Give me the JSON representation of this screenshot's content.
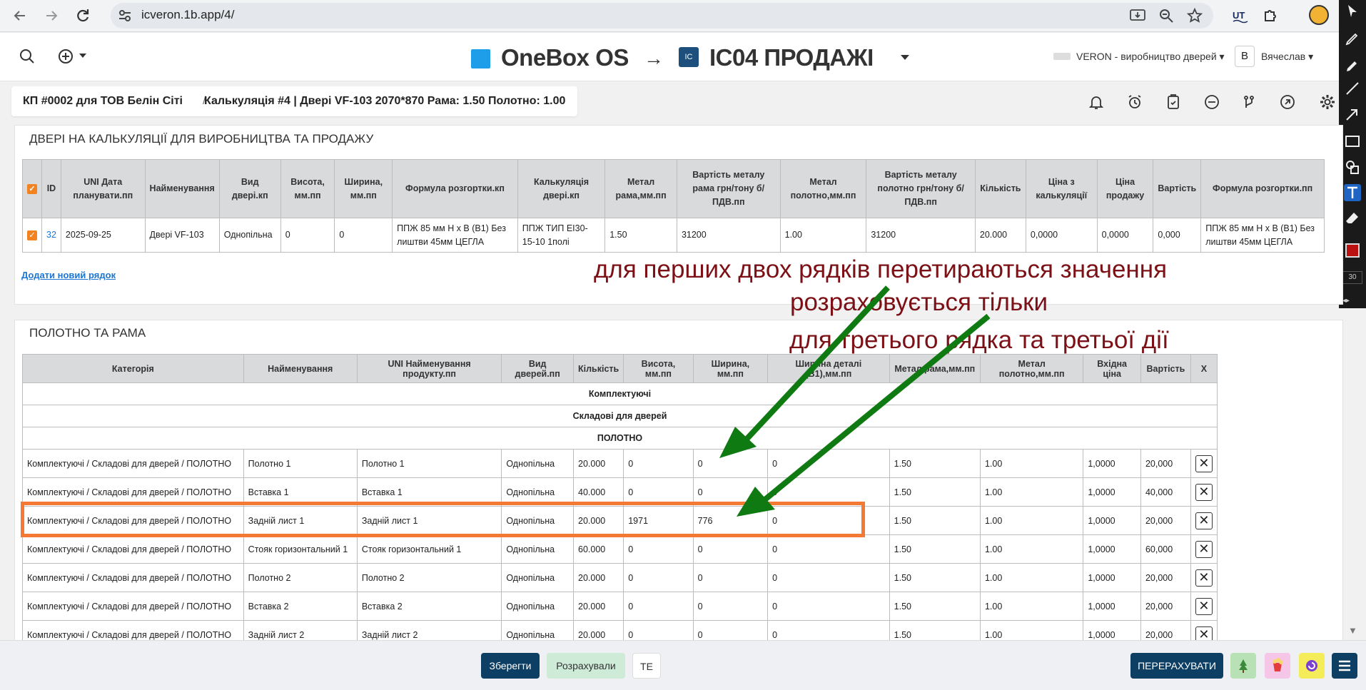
{
  "browser": {
    "url": "icveron.1b.app/4/"
  },
  "header": {
    "brand": "OneBox OS",
    "arrow": "→",
    "project_logo": "IC",
    "project": "IC04 ПРОДАЖІ",
    "company": "VERON - виробництво дверей",
    "user_initial": "В",
    "user": "Вячеслав"
  },
  "breadcrumb": {
    "item1": "КП #0002 для ТОВ Белін Сіті",
    "sep": "/",
    "item2": "Калькуляція #4 | Двері VF-103 2070*870 Рама: 1.50 Полотно: 1.00"
  },
  "panel1": {
    "title": "ДВЕРІ НА КАЛЬКУЛЯЦІЇ ДЛЯ ВИРОБНИЦТВА ТА ПРОДАЖУ",
    "columns": [
      "",
      "ID",
      "UNI Дата планувати.пп",
      "Найменування",
      "Вид двері.кп",
      "Висота, мм.пп",
      "Ширина, мм.пп",
      "Формула розгортки.кп",
      "Калькуляція двері.кп",
      "Метал рама,мм.пп",
      "Вартість металу рама грн/тону б/ПДВ.пп",
      "Метал полотно,мм.пп",
      "Вартість металу полотно грн/тону б/ПДВ.пп",
      "Кількість",
      "Ціна з калькуляції",
      "Ціна продажу",
      "Вартість",
      "Формула розгортки.пп"
    ],
    "row": {
      "checkbox": "✓",
      "id": "32",
      "date": "2025-09-25",
      "name": "Двері VF-103",
      "type": "Однопільна",
      "height": "0",
      "width": "0",
      "formula": "ППЖ 85 мм Н х В (В1) Без лиштви 45мм ЦЕГЛА",
      "calc": "ППЖ ТИП ЕІ30-15-10 1полі",
      "metal_frame": "1.50",
      "cost_frame": "31200",
      "metal_leaf": "1.00",
      "cost_leaf": "31200",
      "qty": "20.000",
      "price_calc": "0,0000",
      "price_sale": "0,0000",
      "total": "0,000",
      "formula_pp": "ППЖ 85 мм Н х В (В1) Без лиштви 45мм ЦЕГЛА"
    },
    "add_row": "Додати новий рядок"
  },
  "panel2": {
    "title": "ПОЛОТНО ТА РАМА",
    "columns": [
      "Категорія",
      "Найменування",
      "UNI Найменування продукту.пп",
      "Вид дверей.пп",
      "Кількість",
      "Висота, мм.пп",
      "Ширина, мм.пп",
      "Ширина деталі (В1),мм.пп",
      "Метал рама,мм.пп",
      "Метал полотно,мм.пп",
      "Вхідна ціна",
      "Вартість",
      "X"
    ],
    "groups": [
      "Комплектуючі",
      "Складові для дверей",
      "ПОЛОТНО"
    ],
    "rows": [
      [
        "Комплектуючі / Складові для дверей / ПОЛОТНО",
        "Полотно 1",
        "Полотно 1",
        "Однопільна",
        "20.000",
        "0",
        "0",
        "0",
        "1.50",
        "1.00",
        "1,0000",
        "20,000"
      ],
      [
        "Комплектуючі / Складові для дверей / ПОЛОТНО",
        "Вставка 1",
        "Вставка 1",
        "Однопільна",
        "40.000",
        "0",
        "0",
        "0",
        "1.50",
        "1.00",
        "1,0000",
        "40,000"
      ],
      [
        "Комплектуючі / Складові для дверей / ПОЛОТНО",
        "Задній лист 1",
        "Задній лист 1",
        "Однопільна",
        "20.000",
        "1971",
        "776",
        "0",
        "1.50",
        "1.00",
        "1,0000",
        "20,000"
      ],
      [
        "Комплектуючі / Складові для дверей / ПОЛОТНО",
        "Стояк горизонтальний 1",
        "Стояк горизонтальний 1",
        "Однопільна",
        "60.000",
        "0",
        "0",
        "0",
        "1.50",
        "1.00",
        "1,0000",
        "60,000"
      ],
      [
        "Комплектуючі / Складові для дверей / ПОЛОТНО",
        "Полотно 2",
        "Полотно 2",
        "Однопільна",
        "20.000",
        "0",
        "0",
        "0",
        "1.50",
        "1.00",
        "1,0000",
        "20,000"
      ],
      [
        "Комплектуючі / Складові для дверей / ПОЛОТНО",
        "Вставка 2",
        "Вставка 2",
        "Однопільна",
        "20.000",
        "0",
        "0",
        "0",
        "1.50",
        "1.00",
        "1,0000",
        "20,000"
      ],
      [
        "Комплектуючі / Складові для дверей / ПОЛОТНО",
        "Задній лист 2",
        "Задній лист 2",
        "Однопільна",
        "20.000",
        "0",
        "0",
        "0",
        "1.50",
        "1.00",
        "1,0000",
        "20,000"
      ]
    ],
    "delete_glyph": "✕"
  },
  "annotations": {
    "line1": "для перших двох рядків перетираються значення",
    "line2": "розраховується тільки",
    "line3": "для третього рядка та третьої дії",
    "text_color": "#7b1116",
    "arrow_color": "#0f7a12",
    "highlight_color": "#f47a34"
  },
  "drawbar": {
    "size": "30",
    "arrows": "◂▸"
  },
  "bottom": {
    "save": "Зберегти",
    "calculated": "Розрахували",
    "te": "TE",
    "recalc": "ПЕРЕРАХУВАТИ"
  },
  "colors": {
    "accent": "#1d76d2",
    "primary_btn": "#0d3e63",
    "checkbox": "#f38221"
  }
}
